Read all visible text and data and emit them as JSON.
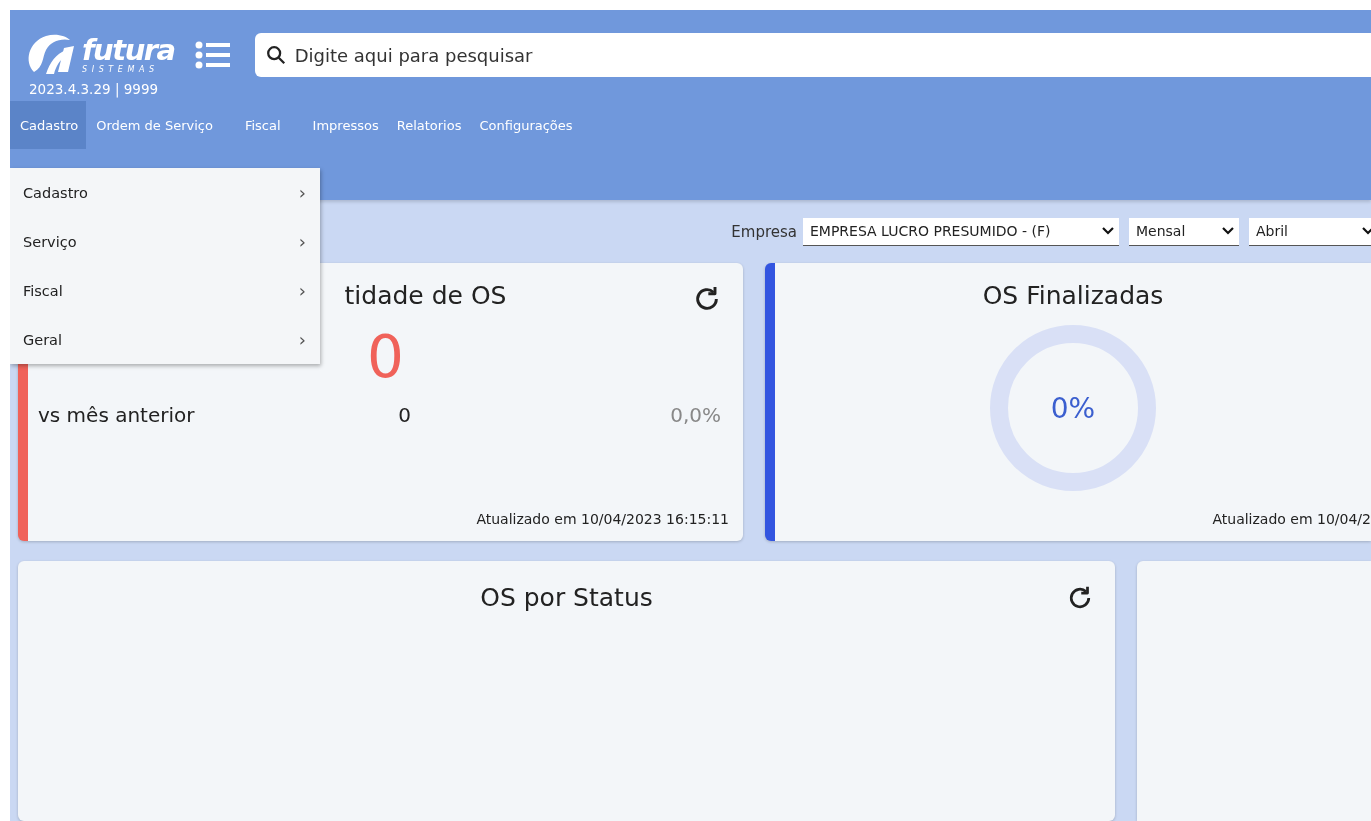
{
  "logo": {
    "name": "futura",
    "tagline": "SISTEMAS"
  },
  "version": "2023.4.3.29 | 9999",
  "search": {
    "placeholder": "Digite aqui para pesquisar"
  },
  "menu": [
    {
      "label": "Cadastro",
      "selected": true
    },
    {
      "label": "Ordem de Serviço",
      "selected": false
    },
    {
      "label": "Fiscal",
      "selected": false
    },
    {
      "label": "Impressos",
      "selected": false
    },
    {
      "label": "Relatorios",
      "selected": false
    },
    {
      "label": "Configurações",
      "selected": false
    }
  ],
  "dropdown": [
    {
      "label": "Cadastro",
      "arrow": "›"
    },
    {
      "label": "Serviço",
      "arrow": "›"
    },
    {
      "label": "Fiscal",
      "arrow": "›"
    },
    {
      "label": "Geral",
      "arrow": "›"
    }
  ],
  "filters": {
    "label": "Empresa",
    "selects": [
      {
        "value": "EMPRESA LUCRO PRESUMIDO - (F)"
      },
      {
        "value": "Mensal"
      },
      {
        "value": "Abril"
      }
    ]
  },
  "cards": [
    {
      "kind": "counter",
      "title": "tidade de OS",
      "color": "#f0625a",
      "value": "0",
      "comparison": {
        "label": "vs mês anterior",
        "value": "0",
        "percent": "0,0%"
      },
      "updated": "Atualizado em 10/04/2023 16:15:11"
    },
    {
      "kind": "donut",
      "title": "OS Finalizadas",
      "color": "#3355e0",
      "value": "0%",
      "updated": "Atualizado em 10/04/2"
    },
    {
      "kind": "chart",
      "title": "OS por Status"
    },
    {
      "kind": "blank"
    }
  ]
}
